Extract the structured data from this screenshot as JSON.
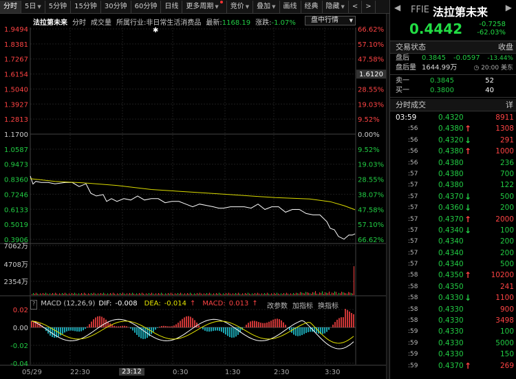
{
  "toolbar": {
    "items": [
      "分时",
      "5日",
      "5分钟",
      "15分钟",
      "30分钟",
      "60分钟",
      "日线",
      "更多周期",
      "竞价",
      "叠加",
      "画线",
      "经典",
      "隐藏"
    ],
    "nav_left": "<",
    "nav_right": ">"
  },
  "info": {
    "stock_name": "法拉第未来",
    "tab_time": "分时",
    "tab_volume": "成交量",
    "industry_label": "所属行业:",
    "industry": "非日常生活消费品",
    "latest_label": "最新:",
    "latest": "1168.19",
    "change_label": "涨跌:",
    "change": "-1.07%",
    "dropdown": "盘中行情"
  },
  "price_axis": {
    "left": [
      "1.9494",
      "1.8381",
      "1.7267",
      "1.6154",
      "1.5040",
      "1.3927",
      "1.2813",
      "1.1700",
      "1.0587",
      "0.9473",
      "0.8360",
      "0.7246",
      "0.6133",
      "0.5019",
      "0.3906"
    ],
    "right": [
      "66.62%",
      "57.10%",
      "47.58%",
      "38.07%",
      "28.55%",
      "19.03%",
      "9.52%",
      "0.00%",
      "9.52%",
      "19.03%",
      "28.55%",
      "38.07%",
      "47.58%",
      "57.10%",
      "66.62%"
    ],
    "cursor_price": "1.6120"
  },
  "volume_axis": [
    "7062万",
    "4708万",
    "2354万"
  ],
  "macd": {
    "label": "MACD (12,26,9)",
    "dif_label": "DIF:",
    "dif": "-0.008",
    "dea_label": "DEA:",
    "dea": "-0.014",
    "macd_label": "MACD:",
    "macd_value": "0.013",
    "axis": [
      "0.02",
      "0.00",
      "-0.02",
      "-0.04"
    ],
    "btn_params": "改参数",
    "btn_add": "加指标",
    "btn_switch": "换指标"
  },
  "time_axis": {
    "labels": [
      "05/29",
      "22:30",
      "0:30",
      "1:30",
      "2:30",
      "3:30"
    ],
    "cursor": "23:12"
  },
  "panel": {
    "code": "FFIE",
    "name": "法拉第未来",
    "price": "0.4442",
    "change": "-0.7258",
    "change_pct": "-62.03%",
    "nav_left": "◀",
    "nav_right": "▶",
    "status_title": "交易状态",
    "status_value": "收盘",
    "after_label": "盘后",
    "after_price": "0.3845",
    "after_change": "-0.0597",
    "after_pct": "-13.44%",
    "after_vol_label": "盘后量",
    "after_vol": "1644.99万",
    "after_time": "20:00 美东",
    "ask_label": "卖一",
    "ask_price": "0.3845",
    "ask_vol": "52",
    "bid_label": "买一",
    "bid_price": "0.3800",
    "bid_vol": "40",
    "ticks_title": "分时成交",
    "ticks_detail": "详"
  },
  "ticks": [
    {
      "t": "03:59",
      "p": "0.4320",
      "dir": "",
      "v": "8911",
      "vc": "up"
    },
    {
      "t": ":56",
      "p": "0.4380",
      "dir": "up",
      "v": "1308",
      "vc": "up"
    },
    {
      "t": ":56",
      "p": "0.4320",
      "dir": "down",
      "v": "291",
      "vc": "up"
    },
    {
      "t": ":56",
      "p": "0.4380",
      "dir": "up",
      "v": "1000",
      "vc": "up"
    },
    {
      "t": ":56",
      "p": "0.4380",
      "dir": "",
      "v": "236",
      "vc": "down"
    },
    {
      "t": ":57",
      "p": "0.4380",
      "dir": "",
      "v": "700",
      "vc": "down"
    },
    {
      "t": ":57",
      "p": "0.4380",
      "dir": "",
      "v": "122",
      "vc": "down"
    },
    {
      "t": ":57",
      "p": "0.4370",
      "dir": "down",
      "v": "500",
      "vc": "down"
    },
    {
      "t": ":57",
      "p": "0.4360",
      "dir": "down",
      "v": "200",
      "vc": "down"
    },
    {
      "t": ":57",
      "p": "0.4370",
      "dir": "up",
      "v": "2000",
      "vc": "up"
    },
    {
      "t": ":57",
      "p": "0.4340",
      "dir": "down",
      "v": "100",
      "vc": "down"
    },
    {
      "t": ":57",
      "p": "0.4340",
      "dir": "",
      "v": "200",
      "vc": "down"
    },
    {
      "t": ":57",
      "p": "0.4340",
      "dir": "",
      "v": "200",
      "vc": "down"
    },
    {
      "t": ":57",
      "p": "0.4340",
      "dir": "",
      "v": "500",
      "vc": "down"
    },
    {
      "t": ":58",
      "p": "0.4350",
      "dir": "up",
      "v": "10200",
      "vc": "up"
    },
    {
      "t": ":58",
      "p": "0.4350",
      "dir": "",
      "v": "241",
      "vc": "up"
    },
    {
      "t": ":58",
      "p": "0.4330",
      "dir": "down",
      "v": "1100",
      "vc": "up"
    },
    {
      "t": ":58",
      "p": "0.4330",
      "dir": "",
      "v": "900",
      "vc": "up"
    },
    {
      "t": ":58",
      "p": "0.4330",
      "dir": "",
      "v": "3498",
      "vc": "up"
    },
    {
      "t": ":59",
      "p": "0.4330",
      "dir": "",
      "v": "100",
      "vc": "down"
    },
    {
      "t": ":59",
      "p": "0.4330",
      "dir": "",
      "v": "5000",
      "vc": "down"
    },
    {
      "t": ":59",
      "p": "0.4330",
      "dir": "",
      "v": "150",
      "vc": "down"
    },
    {
      "t": ":59",
      "p": "0.4370",
      "dir": "up",
      "v": "269",
      "vc": "up"
    }
  ],
  "colors": {
    "up": "#ff4444",
    "down": "#22cc44",
    "price_line": "#ffffff",
    "avg_line": "#dcdc00",
    "dea_line": "#e6e600",
    "macd_pos": "#ff4444",
    "macd_neg": "#22d0e0"
  }
}
